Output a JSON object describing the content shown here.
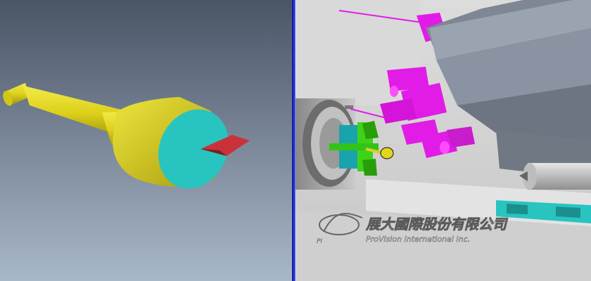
{
  "watermark": {
    "company_zh": "展大國際股份有限公司",
    "company_en": "ProVision International Inc.",
    "logo_prefix": "PI"
  },
  "colors": {
    "workpiece_yellow": "#e2d61d",
    "face_cyan": "#28c4c0",
    "tool_red": "#c9323b",
    "turret_magenta": "#e21ce7",
    "chuck_green": "#3ed316",
    "viewport_bg_top": "#4a5566",
    "viewport_bg_bottom": "#a9b8c8",
    "splitter_blue": "#1f2fcf"
  },
  "viewports": [
    {
      "name": "detail-view",
      "content": "workpiece-with-cutting-tool"
    },
    {
      "name": "machine-view",
      "content": "lathe-turret-and-chuck"
    }
  ]
}
